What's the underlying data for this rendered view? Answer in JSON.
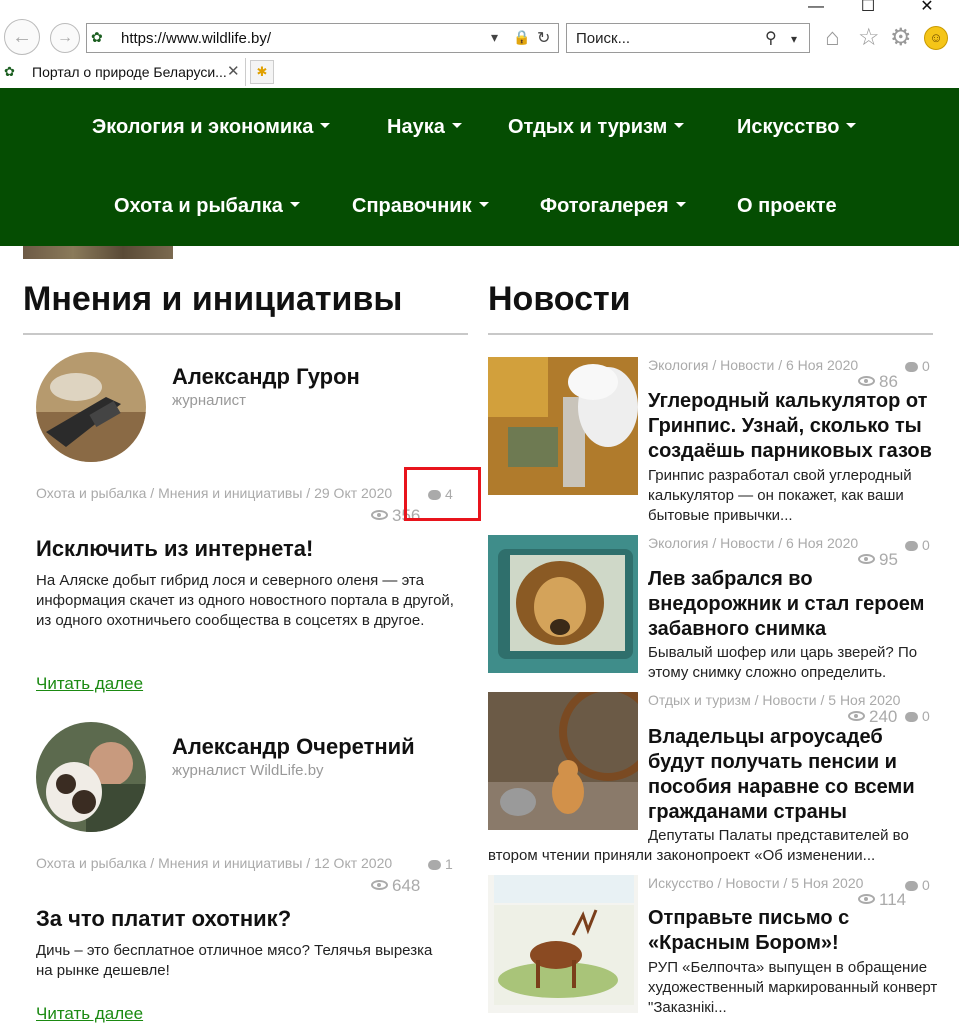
{
  "browser": {
    "window_controls": {
      "minimize": "—",
      "maximize": "☐",
      "close": "✕"
    },
    "back_icon": "arrow-left-icon",
    "forward_icon": "arrow-right-icon",
    "url": "https://www.wildlife.by/",
    "search_placeholder": "Поиск...",
    "tab_title": "Портал о природе Беларуси...",
    "tab_close": "✕"
  },
  "menu": {
    "items": [
      {
        "label": "Экология и экономика",
        "dropdown": true
      },
      {
        "label": "Наука",
        "dropdown": true
      },
      {
        "label": "Отдых и туризм",
        "dropdown": true
      },
      {
        "label": "Искусство",
        "dropdown": true
      },
      {
        "label": "Охота и рыбалка",
        "dropdown": true
      },
      {
        "label": "Справочник",
        "dropdown": true
      },
      {
        "label": "Фотогалерея",
        "dropdown": true
      },
      {
        "label": "О проекте",
        "dropdown": false
      }
    ],
    "background": "#054d02"
  },
  "opinions": {
    "title": "Мнения и инициативы",
    "posts": [
      {
        "author": "Александр Гурон",
        "role": "журналист",
        "meta": "Охота и рыбалка / Мнения и инициативы / 29 Окт 2020",
        "comments": "4",
        "views": "356",
        "title": "Исключить из интернета!",
        "text": "На Аляске добыт гибрид лося и северного оленя — эта информация скачет из одного новостного портала в другой, из одного охотничьего сообщества в соцсетях в другое.",
        "read_more": "Читать далее"
      },
      {
        "author": "Александр Очеретний",
        "role": "журналист WildLife.by",
        "meta": "Охота и рыбалка / Мнения и инициативы / 12 Окт 2020",
        "comments": "1",
        "views": "648",
        "title": "За что платит охотник?",
        "text": "Дичь – это бесплатное отличное мясо? Телячья вырезка на рынке дешевле!",
        "read_more": "Читать далее"
      }
    ]
  },
  "news": {
    "title": "Новости",
    "items": [
      {
        "meta": "Экология / Новости / 6 Ноя 2020",
        "comments": "0",
        "views": "86",
        "title": "Углеродный калькулятор от Гринпис. Узнай, сколько ты создаёшь парниковых газов",
        "text": "Гринпис разработал свой углеродный калькулятор — он покажет, как ваши бытовые привычки..."
      },
      {
        "meta": "Экология / Новости / 6 Ноя 2020",
        "comments": "0",
        "views": "95",
        "title": "Лев забрался во внедорожник и стал героем забавного снимка",
        "text": "Бывалый шофер или царь зверей? По этому снимку сложно определить."
      },
      {
        "meta": "Отдых и туризм / Новости / 5 Ноя 2020",
        "comments": "0",
        "views": "240",
        "title": "Владельцы агроусадеб будут получать пенсии и пособия наравне со всеми гражданами страны",
        "text": "Депутаты Палаты представителей во втором чтении приняли законопроект «Об изменении..."
      },
      {
        "meta": "Искусство / Новости / 5 Ноя 2020",
        "comments": "0",
        "views": "114",
        "title": "Отправьте письмо с «Красным Бором»!",
        "text": "РУП «Белпочта» выпущен в обращение художественный маркированный конверт \"Заказнікі..."
      }
    ]
  },
  "colors": {
    "accent": "#054d02",
    "link": "#1b8a12",
    "highlight": "#e8141c"
  }
}
